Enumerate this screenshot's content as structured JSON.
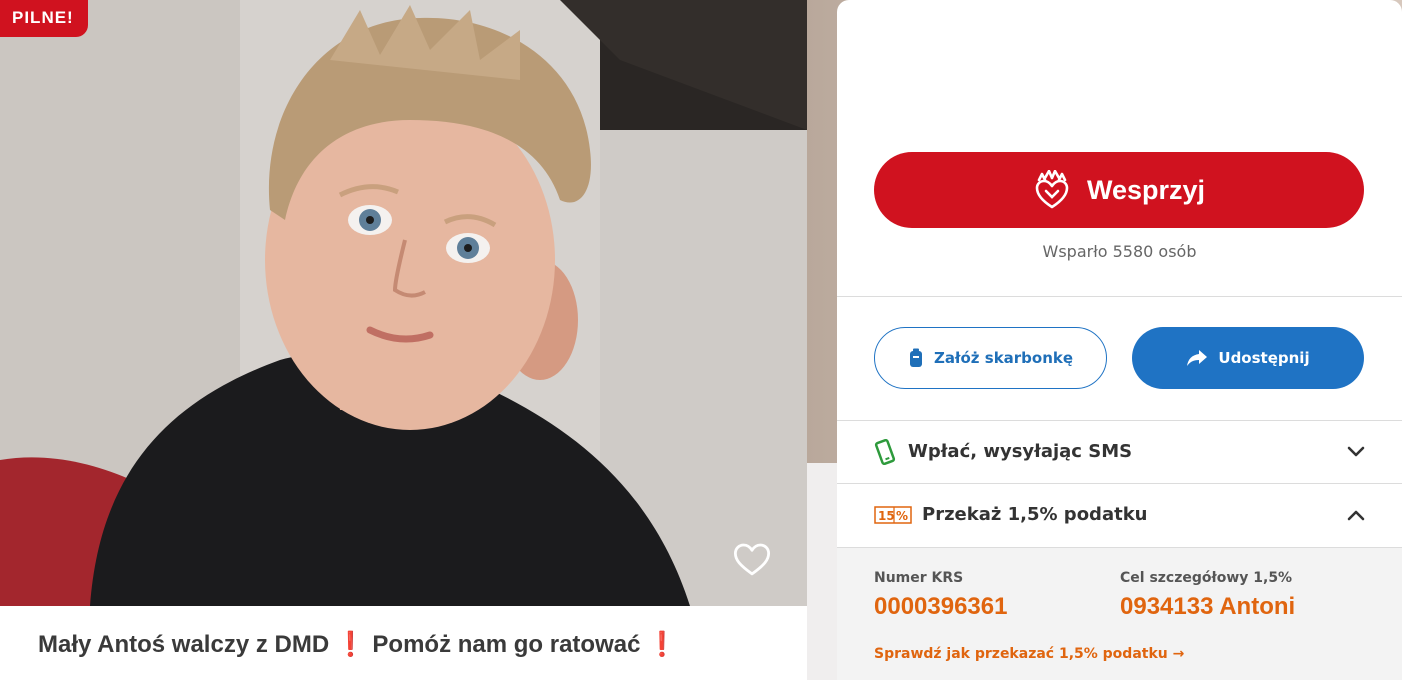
{
  "campaign": {
    "urgent_badge": "PILNE!",
    "title_part1": "Mały Antoś walczy z DMD",
    "title_mark": "❗",
    "title_part2": "Pomóż nam go ratować",
    "heart_icon": "heart-outline-icon"
  },
  "support": {
    "button_label": "Wesprzyj",
    "button_icon": "heart-hand-icon",
    "supporters_text": "Wsparło 5580 osób"
  },
  "actions": {
    "piggybank_label": "Załóż skarbonkę",
    "piggybank_icon": "piggybank-icon",
    "share_label": "Udostępnij",
    "share_icon": "share-arrow-icon"
  },
  "sms": {
    "label": "Wpłać, wysyłając SMS",
    "icon": "phone-icon",
    "expanded": false
  },
  "tax": {
    "badge": "1,5%",
    "label": "Przekaż 1,5% podatku",
    "expanded": true,
    "krs_label": "Numer KRS",
    "krs_value": "0000396361",
    "goal_label": "Cel szczegółowy 1,5%",
    "goal_value": "0934133 Antoni",
    "link_text": "Sprawdź jak przekazać 1,5% podatku",
    "link_arrow": "→"
  },
  "colors": {
    "brand_red": "#d0121f",
    "brand_blue": "#1f73c4",
    "accent_orange": "#e0650f",
    "sms_green": "#2e9a3c"
  }
}
